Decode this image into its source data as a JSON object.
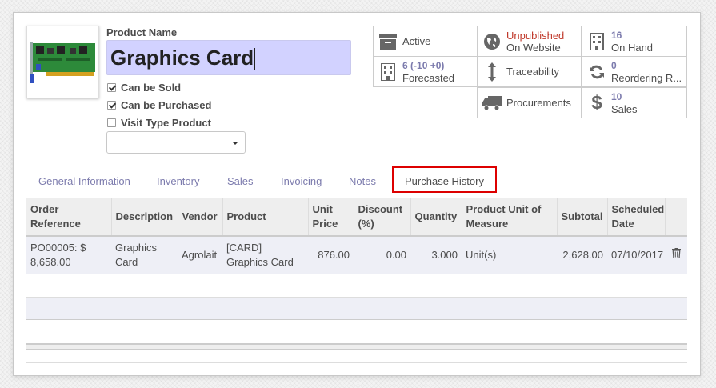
{
  "product": {
    "name_label": "Product Name",
    "name_value": "Graphics Card",
    "checkboxes": [
      {
        "label": "Can be Sold",
        "checked": true
      },
      {
        "label": "Can be Purchased",
        "checked": true
      },
      {
        "label": "Visit Type Product",
        "checked": false
      }
    ],
    "select_value": ""
  },
  "stats": {
    "active": {
      "label": "Active",
      "icon": "archive-icon"
    },
    "website": {
      "line1": "Unpublished",
      "line2": "On Website",
      "icon": "globe-icon"
    },
    "onhand": {
      "value": "16",
      "label": "On Hand",
      "icon": "building-icon"
    },
    "forecasted": {
      "value": "6",
      "detail_neg": "-10",
      "detail_pos": "+0",
      "label": "Forecasted",
      "icon": "building-icon"
    },
    "traceability": {
      "label": "Traceability",
      "icon": "arrows-vertical-icon"
    },
    "reordering": {
      "value": "0",
      "label": "Reordering R...",
      "icon": "refresh-icon"
    },
    "procurements": {
      "label": "Procurements",
      "icon": "truck-icon"
    },
    "sales": {
      "value": "10",
      "label": "Sales",
      "icon": "dollar-icon"
    }
  },
  "tabs": [
    {
      "label": "General Information"
    },
    {
      "label": "Inventory"
    },
    {
      "label": "Sales"
    },
    {
      "label": "Invoicing"
    },
    {
      "label": "Notes"
    },
    {
      "label": "Purchase History",
      "active": true
    }
  ],
  "grid": {
    "headers": [
      "Order Reference",
      "Description",
      "Vendor",
      "Product",
      "Unit Price",
      "Discount (%)",
      "Quantity",
      "Product Unit of Measure",
      "Subtotal",
      "Scheduled Date"
    ],
    "rows": [
      {
        "order_ref": "PO00005: $ 8,658.00",
        "description": "Graphics Card",
        "vendor": "Agrolait",
        "product": "[CARD] Graphics Card",
        "unit_price": "876.00",
        "discount": "0.00",
        "quantity": "3.000",
        "uom": "Unit(s)",
        "subtotal": "2,628.00",
        "scheduled_date": "07/10/2017"
      }
    ]
  },
  "colors": {
    "accent": "#7c7bad",
    "active_green": "#2a8a2a",
    "unpublished_red": "#c0392b",
    "highlight_border": "#dd0000",
    "name_field_bg": "#d2d2ff"
  }
}
